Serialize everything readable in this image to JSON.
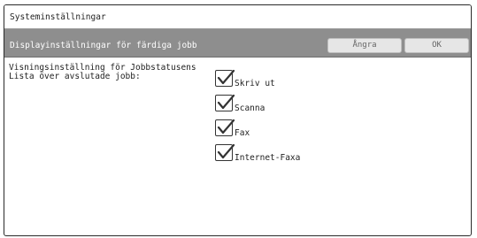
{
  "window": {
    "title": "Systeminställningar"
  },
  "header": {
    "title": "Displayinställningar för färdiga jobb",
    "cancel_label": "Ångra",
    "ok_label": "OK"
  },
  "setting": {
    "label": "Visningsinställning för Jobbstatusens\nLista över avslutade jobb:"
  },
  "options": [
    {
      "label": "Skriv ut",
      "checked": true
    },
    {
      "label": "Scanna",
      "checked": true
    },
    {
      "label": "Fax",
      "checked": true
    },
    {
      "label": "Internet-Faxa",
      "checked": true
    }
  ],
  "icons": {
    "checkbox": "checkmark-icon"
  },
  "colors": {
    "header_bg": "#8e8e8e",
    "button_bg": "#e6e6e6",
    "border": "#2a2a2a"
  }
}
